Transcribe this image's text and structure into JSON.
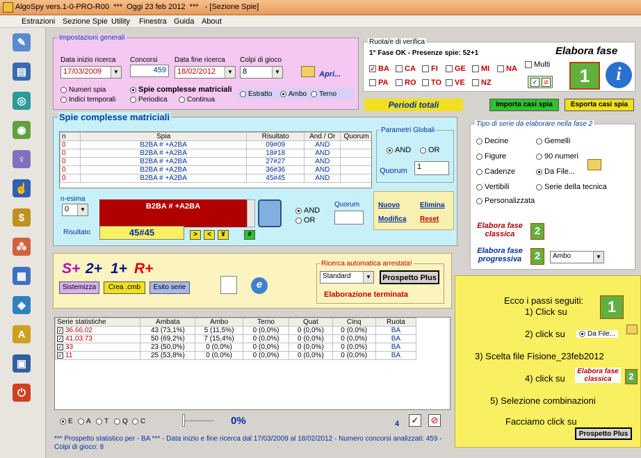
{
  "window": {
    "title": "AlgoSpy vers.1-0-PRO-R00  ***  Oggi 23 feb 2012  ***   - [Sezione Spie]"
  },
  "menu": [
    "Estrazioni",
    "Sezione Spie",
    "Utility",
    "Finestra",
    "Guida",
    "About"
  ],
  "sidebar": [
    "pencil-icon",
    "book-icon",
    "compass-icon",
    "pills-icon",
    "bulb-icon",
    "hand-icon",
    "dollar-icon",
    "tree-icon",
    "grid-icon",
    "shape-icon",
    "letter-a-icon",
    "monitor-icon",
    "power-icon"
  ],
  "impostazioni": {
    "title": "Impostazioni generali",
    "data_inizio_label": "Data inizio ricerca",
    "data_inizio": "17/03/2009",
    "concorsi_label": "Concorsi",
    "concorsi": "459",
    "data_fine_label": "Data fine ricerca",
    "data_fine": "18/02/2012",
    "colpi_label": "Colpi di gioco",
    "colpi": "8",
    "apri": "Apri...",
    "numeri_spia": "Numeri spia",
    "spie_complesse": "Spie complesse matriciali",
    "indici_temporali": "Indici temporali",
    "periodica": "Periodica",
    "continua": "Continua",
    "estratto": "Estratto",
    "ambo": "Ambo",
    "terno": "Terno"
  },
  "ruota": {
    "title": "Ruota/e di verifica",
    "status": "1° Fase OK - Presenze spie: 52+1",
    "row1": [
      "BA",
      "CA",
      "FI",
      "GE",
      "MI",
      "NA"
    ],
    "row2": [
      "PA",
      "RO",
      "TO",
      "VE",
      "NZ"
    ],
    "multi": "Multi",
    "elabora_fase": "Elabora fase",
    "periodi": "Periodi totali",
    "importa": "Importa casi spia",
    "esporta": "Esporta casi spia",
    "fase_number": "1",
    "info_letter": "i"
  },
  "spie": {
    "title": "Spie complesse matriciali",
    "headers": [
      "n",
      "Spia",
      "Risultato",
      "And / Or",
      "Quorum"
    ],
    "rows": [
      [
        "0",
        "B2BA # +A2BA",
        "09#09",
        "AND",
        ""
      ],
      [
        "0",
        "B2BA # +A2BA",
        "18#18",
        "AND",
        ""
      ],
      [
        "0",
        "B2BA # +A2BA",
        "27#27",
        "AND",
        ""
      ],
      [
        "0",
        "B2BA # +A2BA",
        "36#36",
        "AND",
        ""
      ],
      [
        "0",
        "B2BA # +A2BA",
        "45#45",
        "AND",
        ""
      ]
    ],
    "parametri": "Parametri Globali",
    "and": "AND",
    "or": "OR",
    "quorum_label": "Quorum",
    "quorum": "1",
    "nesima": "n-esima",
    "nesima_val": "0",
    "formula": "B2BA # +A2BA",
    "risultato_label": "Risultato",
    "risultato": "45#45",
    "btns": [
      ">",
      "<",
      "¥",
      "#"
    ],
    "quorum2": "Quorum",
    "nuovo": "Nuovo",
    "elimina": "Elimina",
    "modifica": "Modifica",
    "reset": "Reset"
  },
  "tipo": {
    "title": "Tipo di serie da elaborare nella fase 2",
    "options": [
      "Decine",
      "Gemelli",
      "Figure",
      "90 numeri",
      "Cadenze",
      "Da File...",
      "Vertibili",
      "Serie della tecnica",
      "Personalizzata"
    ],
    "classica": "Elabora fase classica",
    "progressiva": "Elabora fase progressiva",
    "progressiva_combo": "Ambo",
    "fase_number": "2"
  },
  "mid": {
    "s": "S+",
    "n2": "2+",
    "n1": "1+",
    "r": "R+",
    "sistemizza": "Sistemizza",
    "crea": "Crea .cmb",
    "esito": "Esito serie",
    "ricerca": "Ricerca automatica arrestata!",
    "standard": "Standard",
    "prospetto": "Prospetto Plus",
    "terminata": "Elaborazione terminata"
  },
  "stats": {
    "headers": [
      "Serie statistiche",
      "Ambata",
      "Ambo",
      "Terno",
      "Quat",
      "Cinq",
      "Ruota"
    ],
    "rows": [
      [
        "36.66.02",
        "43 (73,1%)",
        "5 (11,5%)",
        "0 (0,0%)",
        "0 (0,0%)",
        "0 (0,0%)",
        "BA"
      ],
      [
        "41.03.73",
        "50 (69,2%)",
        "7 (15,4%)",
        "0 (0,0%)",
        "0 (0,0%)",
        "0 (0,0%)",
        "BA"
      ],
      [
        "33",
        "23 (50,0%)",
        "0 (0,0%)",
        "0 (0,0%)",
        "0 (0,0%)",
        "0 (0,0%)",
        "BA"
      ],
      [
        "11",
        "25 (53,8%)",
        "0 (0,0%)",
        "0 (0,0%)",
        "0 (0,0%)",
        "0 (0,0%)",
        "BA"
      ]
    ]
  },
  "bottom": {
    "radios": [
      "E",
      "A",
      "T",
      "Q",
      "C"
    ],
    "percent": "0%",
    "count": "4",
    "status": "*** Prospetto statistico per  - BA ***  - Data inizio e fine ricerca dal 17/03/2009 al 18/02/2012 - Numero concorsi analizzati: 459 - Colpi di gioco: 8"
  },
  "note": {
    "title": "Ecco i passi seguiti:",
    "s1": "1) Click su",
    "s2": "2) click su",
    "s2val": "Da File...",
    "s3": "3) Scelta file Fisione_23feb2012",
    "s4": "4) click su",
    "s4val": "Elabora fase classica",
    "s5": "5) Selezione combinazioni",
    "s6": "Facciamo click su",
    "s6btn": "Prospetto Plus",
    "fase_number": "1",
    "fase2_number": "2"
  }
}
